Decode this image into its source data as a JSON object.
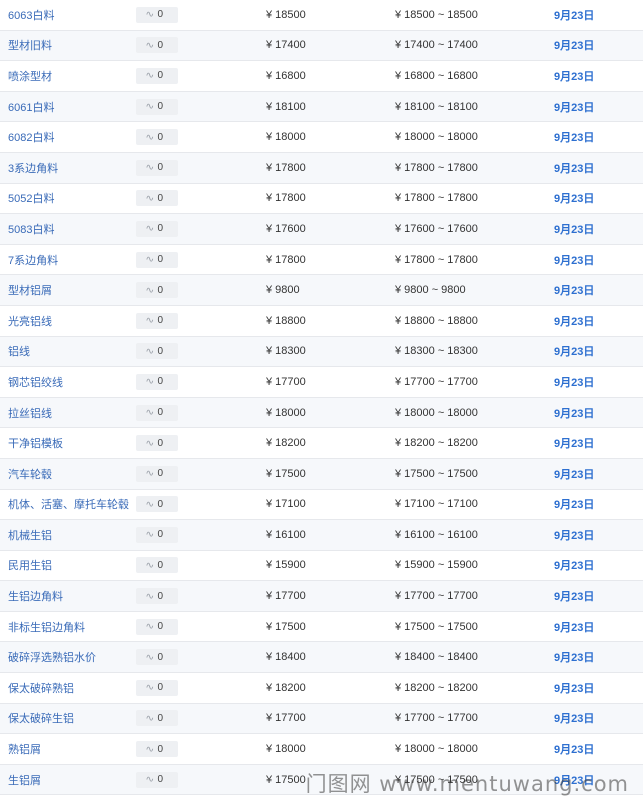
{
  "rows": [
    {
      "name": "6063白料",
      "change": "0",
      "price": "¥ 18500",
      "range": "¥ 18500 ~ 18500",
      "date": "9月23日"
    },
    {
      "name": "型材旧料",
      "change": "0",
      "price": "¥ 17400",
      "range": "¥ 17400 ~ 17400",
      "date": "9月23日"
    },
    {
      "name": "喷涂型材",
      "change": "0",
      "price": "¥ 16800",
      "range": "¥ 16800 ~ 16800",
      "date": "9月23日"
    },
    {
      "name": "6061白料",
      "change": "0",
      "price": "¥ 18100",
      "range": "¥ 18100 ~ 18100",
      "date": "9月23日"
    },
    {
      "name": "6082白料",
      "change": "0",
      "price": "¥ 18000",
      "range": "¥ 18000 ~ 18000",
      "date": "9月23日"
    },
    {
      "name": "3系边角料",
      "change": "0",
      "price": "¥ 17800",
      "range": "¥ 17800 ~ 17800",
      "date": "9月23日"
    },
    {
      "name": "5052白料",
      "change": "0",
      "price": "¥ 17800",
      "range": "¥ 17800 ~ 17800",
      "date": "9月23日"
    },
    {
      "name": "5083白料",
      "change": "0",
      "price": "¥ 17600",
      "range": "¥ 17600 ~ 17600",
      "date": "9月23日"
    },
    {
      "name": "7系边角料",
      "change": "0",
      "price": "¥ 17800",
      "range": "¥ 17800 ~ 17800",
      "date": "9月23日"
    },
    {
      "name": "型材铝屑",
      "change": "0",
      "price": "¥ 9800",
      "range": "¥ 9800 ~ 9800",
      "date": "9月23日"
    },
    {
      "name": "光亮铝线",
      "change": "0",
      "price": "¥ 18800",
      "range": "¥ 18800 ~ 18800",
      "date": "9月23日"
    },
    {
      "name": "铝线",
      "change": "0",
      "price": "¥ 18300",
      "range": "¥ 18300 ~ 18300",
      "date": "9月23日"
    },
    {
      "name": "钢芯铝绞线",
      "change": "0",
      "price": "¥ 17700",
      "range": "¥ 17700 ~ 17700",
      "date": "9月23日"
    },
    {
      "name": "拉丝铝线",
      "change": "0",
      "price": "¥ 18000",
      "range": "¥ 18000 ~ 18000",
      "date": "9月23日"
    },
    {
      "name": "干净铝模板",
      "change": "0",
      "price": "¥ 18200",
      "range": "¥ 18200 ~ 18200",
      "date": "9月23日"
    },
    {
      "name": "汽车轮毂",
      "change": "0",
      "price": "¥ 17500",
      "range": "¥ 17500 ~ 17500",
      "date": "9月23日"
    },
    {
      "name": "机体、活塞、摩托车轮毂",
      "change": "0",
      "price": "¥ 17100",
      "range": "¥ 17100 ~ 17100",
      "date": "9月23日"
    },
    {
      "name": "机械生铝",
      "change": "0",
      "price": "¥ 16100",
      "range": "¥ 16100 ~ 16100",
      "date": "9月23日"
    },
    {
      "name": "民用生铝",
      "change": "0",
      "price": "¥ 15900",
      "range": "¥ 15900 ~ 15900",
      "date": "9月23日"
    },
    {
      "name": "生铝边角料",
      "change": "0",
      "price": "¥ 17700",
      "range": "¥ 17700 ~ 17700",
      "date": "9月23日"
    },
    {
      "name": "非标生铝边角料",
      "change": "0",
      "price": "¥ 17500",
      "range": "¥ 17500 ~ 17500",
      "date": "9月23日"
    },
    {
      "name": "破碎浮选熟铝水价",
      "change": "0",
      "price": "¥ 18400",
      "range": "¥ 18400 ~ 18400",
      "date": "9月23日"
    },
    {
      "name": "保太破碎熟铝",
      "change": "0",
      "price": "¥ 18200",
      "range": "¥ 18200 ~ 18200",
      "date": "9月23日"
    },
    {
      "name": "保太破碎生铝",
      "change": "0",
      "price": "¥ 17700",
      "range": "¥ 17700 ~ 17700",
      "date": "9月23日"
    },
    {
      "name": "熟铝屑",
      "change": "0",
      "price": "¥ 18000",
      "range": "¥ 18000 ~ 18000",
      "date": "9月23日"
    },
    {
      "name": "生铝屑",
      "change": "0",
      "price": "¥ 17500",
      "range": "¥ 17500 ~ 17500",
      "date": "9月23日"
    }
  ],
  "change_icon": "tilde-wave-icon",
  "watermark": "门图网 www.mentuwang.com",
  "colors": {
    "name_link": "#3a6bb8",
    "date_link": "#2d6fd0",
    "row_alt": "#f6f8fb",
    "border": "#e6e8ec"
  }
}
